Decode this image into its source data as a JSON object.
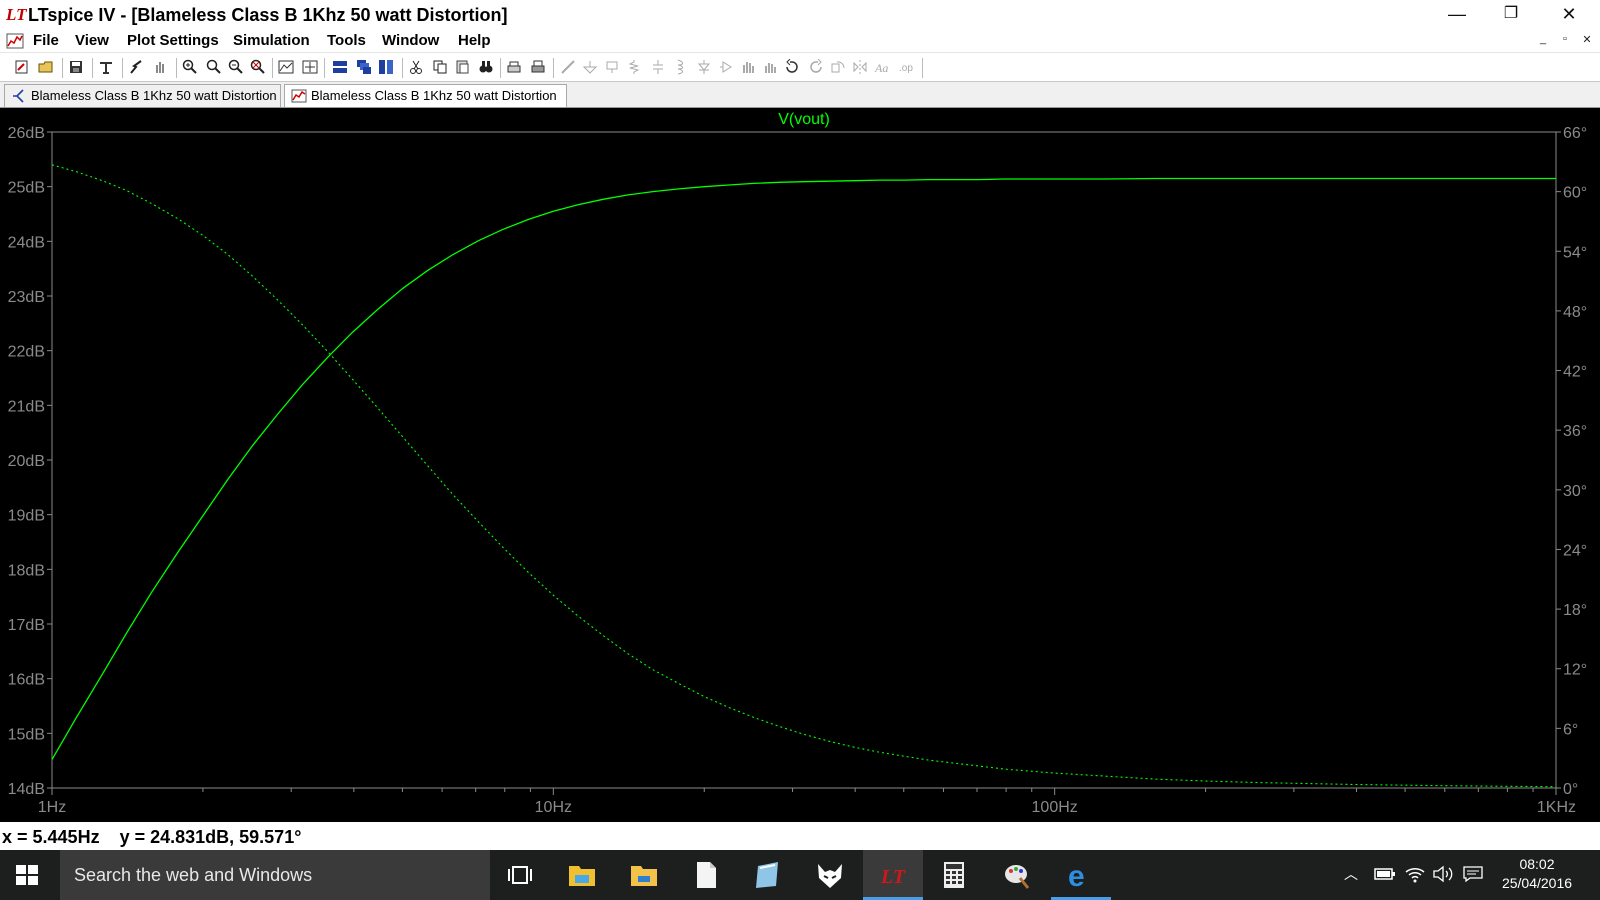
{
  "window": {
    "app_logo": "LT",
    "title": "LTspice IV - [Blameless Class B 1Khz 50 watt Distortion]",
    "minimize": "—",
    "restore": "❐",
    "close": "✕"
  },
  "menu": {
    "items": [
      "File",
      "View",
      "Plot Settings",
      "Simulation",
      "Tools",
      "Window",
      "Help"
    ],
    "mdi_min": "_",
    "mdi_restore": "▫",
    "mdi_close": "✕"
  },
  "toolbar": {
    "icons": [
      "new-schematic-icon",
      "open-icon",
      "save-icon",
      "control-panel-icon",
      "run-icon",
      "halt-icon",
      "zoom-in-icon",
      "zoom-extent-icon",
      "zoom-out-icon",
      "zoom-cancel-icon",
      "autorange-icon",
      "mark-data-icon",
      "tile-horizontal-icon",
      "cascade-icon",
      "tile-vertical-icon",
      "cut-icon",
      "copy-icon",
      "paste-icon",
      "find-icon",
      "print-setup-icon",
      "print-icon",
      "wire-icon",
      "ground-icon",
      "label-icon",
      "resistor-icon",
      "capacitor-icon",
      "inductor-icon",
      "diode-icon",
      "component-icon",
      "move-icon",
      "drag-icon",
      "undo-icon",
      "redo-icon",
      "rotate-icon",
      "mirror-icon",
      "text-icon",
      "spice-directive-icon"
    ]
  },
  "tabs": [
    {
      "label": "Blameless Class B 1Khz 50 watt Distortion",
      "kind": "schematic"
    },
    {
      "label": "Blameless Class B 1Khz 50 watt Distortion",
      "kind": "waveform"
    }
  ],
  "chart_data": {
    "type": "line",
    "title": "V(vout)",
    "xlabel": "",
    "ylabel": "",
    "x_scale": "log",
    "xlim": [
      1,
      1000
    ],
    "ylim": [
      14,
      26
    ],
    "y2lim": [
      0,
      66
    ],
    "grid": false,
    "x_ticks": [
      "1Hz",
      "10Hz",
      "100Hz",
      "1KHz"
    ],
    "y_ticks": [
      "26dB",
      "25dB",
      "24dB",
      "23dB",
      "22dB",
      "21dB",
      "20dB",
      "19dB",
      "18dB",
      "17dB",
      "16dB",
      "15dB",
      "14dB"
    ],
    "y2_ticks": [
      "66°",
      "60°",
      "54°",
      "48°",
      "42°",
      "36°",
      "30°",
      "24°",
      "18°",
      "12°",
      "6°",
      "0°"
    ],
    "series": [
      {
        "name": "V(vout)",
        "style": "solid",
        "axis": "left",
        "color": "#00ff00",
        "x": [
          1,
          1.12,
          1.26,
          1.41,
          1.58,
          1.78,
          2.0,
          2.24,
          2.51,
          2.82,
          3.16,
          3.55,
          3.98,
          4.47,
          5.01,
          5.62,
          6.31,
          7.08,
          7.94,
          8.91,
          10,
          11.2,
          12.6,
          14.1,
          15.8,
          17.8,
          20,
          22.4,
          25.1,
          28.2,
          31.6,
          35.5,
          39.8,
          44.7,
          50.1,
          56.2,
          63.1,
          70.8,
          79.4,
          89.1,
          100,
          125.9,
          158.5,
          199.5,
          251.2,
          316.2,
          398.1,
          501.2,
          631,
          794.3,
          1000
        ],
        "values": [
          14.52,
          15.3,
          16.08,
          16.84,
          17.58,
          18.3,
          18.98,
          19.64,
          20.26,
          20.84,
          21.38,
          21.88,
          22.34,
          22.76,
          23.14,
          23.47,
          23.76,
          24.01,
          24.22,
          24.4,
          24.55,
          24.67,
          24.77,
          24.85,
          24.91,
          24.96,
          25.0,
          25.03,
          25.06,
          25.08,
          25.09,
          25.1,
          25.11,
          25.12,
          25.12,
          25.13,
          25.13,
          25.13,
          25.14,
          25.14,
          25.14,
          25.14,
          25.15,
          25.15,
          25.15,
          25.15,
          25.15,
          25.15,
          25.15,
          25.15,
          25.15
        ]
      },
      {
        "name": "V(vout) phase",
        "style": "dotted",
        "axis": "right",
        "color": "#00ff00",
        "x": [
          1,
          1.12,
          1.26,
          1.41,
          1.58,
          1.78,
          2.0,
          2.24,
          2.51,
          2.82,
          3.16,
          3.55,
          3.98,
          4.47,
          5.01,
          5.62,
          6.31,
          7.08,
          7.94,
          8.91,
          10,
          11.2,
          12.6,
          14.1,
          15.8,
          17.8,
          20,
          22.4,
          25.1,
          28.2,
          31.6,
          35.5,
          39.8,
          44.7,
          50.1,
          56.2,
          63.1,
          70.8,
          79.4,
          89.1,
          100,
          125.9,
          158.5,
          199.5,
          251.2,
          316.2,
          398.1,
          501.2,
          631,
          794.3,
          1000
        ],
        "values": [
          62.7,
          62.0,
          61.1,
          60.1,
          58.8,
          57.3,
          55.6,
          53.7,
          51.5,
          49.1,
          46.6,
          43.9,
          41.1,
          38.2,
          35.3,
          32.4,
          29.5,
          26.8,
          24.2,
          21.7,
          19.4,
          17.3,
          15.3,
          13.5,
          11.9,
          10.5,
          9.2,
          8.1,
          7.1,
          6.2,
          5.4,
          4.7,
          4.1,
          3.6,
          3.2,
          2.8,
          2.5,
          2.2,
          1.9,
          1.7,
          1.5,
          1.2,
          0.9,
          0.7,
          0.55,
          0.45,
          0.35,
          0.28,
          0.22,
          0.17,
          0.13
        ]
      }
    ]
  },
  "status": {
    "readout": "x = 5.445Hz    y = 24.831dB, 59.571°"
  },
  "taskbar": {
    "search_placeholder": "Search the web and Windows",
    "apps": [
      "task-view-icon",
      "file-explorer-icon",
      "folder-icon",
      "document-icon",
      "notepad-icon",
      "firefox-icon",
      "ltspice-icon",
      "calculator-icon",
      "paint-icon",
      "edge-icon"
    ],
    "clock_time": "08:02",
    "clock_date": "25/04/2016"
  }
}
